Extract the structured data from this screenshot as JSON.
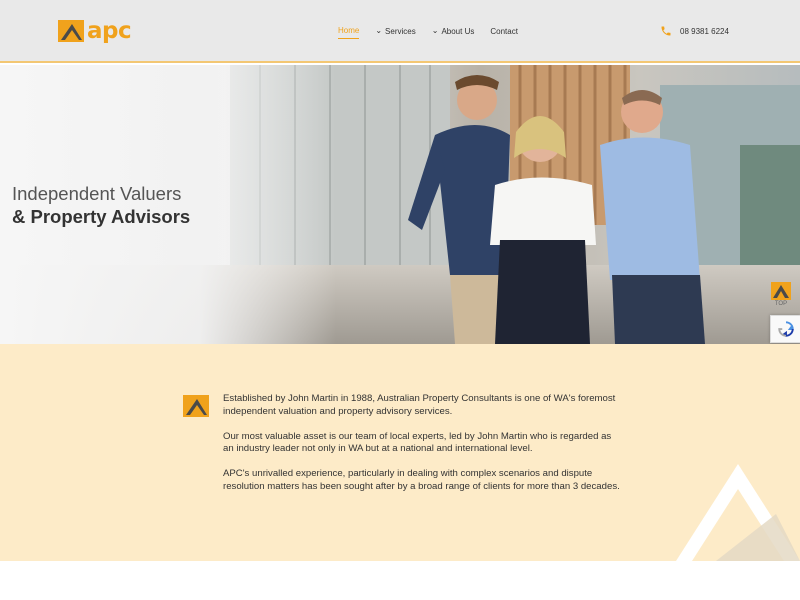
{
  "header": {
    "logo_text": "apc",
    "nav": [
      {
        "label": "Home",
        "active": true,
        "dropdown": false
      },
      {
        "label": "Services",
        "active": false,
        "dropdown": true
      },
      {
        "label": "About Us",
        "active": false,
        "dropdown": true
      },
      {
        "label": "Contact",
        "active": false,
        "dropdown": false
      }
    ],
    "phone": "08 9381 6224",
    "phone_icon": "phone-icon"
  },
  "hero": {
    "headline_line1": "Independent Valuers",
    "headline_line2": "& Property Advisors"
  },
  "widgets": {
    "back_to_top_label": "TOP",
    "recaptcha_icon": "recaptcha-icon"
  },
  "about": {
    "paragraphs": [
      "Established by John Martin in 1988, Australian Property Consultants is one of WA's foremost independent valuation and property advisory services.",
      "Our most valuable asset is our team of local experts, led by John Martin who is regarded as an industry leader not only in WA but at a national and international level.",
      "APC's unrivalled experience, particularly in dealing with complex scenarios and dispute resolution matters has been sought after by a broad range of clients for more than 3 decades."
    ]
  },
  "colors": {
    "accent": "#f0a21c",
    "header_bg": "#e9e9e9",
    "about_bg": "#fdebc8",
    "logo_dark": "#4a4a4a"
  }
}
